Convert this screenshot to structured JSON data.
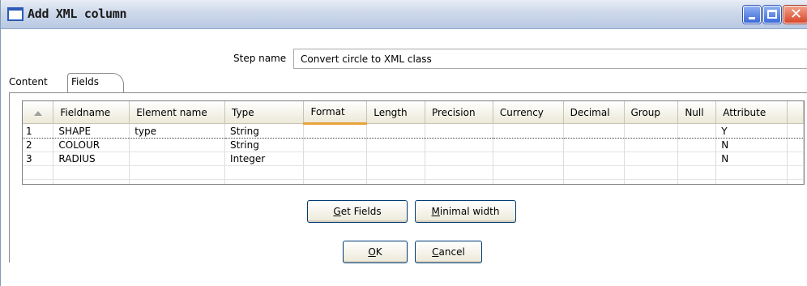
{
  "window": {
    "title": "Add XML column"
  },
  "step": {
    "label": "Step name",
    "value": "Convert circle to XML class"
  },
  "tabs": [
    {
      "label": "Content"
    },
    {
      "label": "Fields"
    }
  ],
  "grid": {
    "columns": [
      "",
      "Fieldname",
      "Element name",
      "Type",
      "Format",
      "Length",
      "Precision",
      "Currency",
      "Decimal",
      "Group",
      "Null",
      "Attribute"
    ],
    "rows": [
      [
        "1",
        "SHAPE",
        "type",
        "String",
        "",
        "",
        "",
        "",
        "",
        "",
        "",
        "Y"
      ],
      [
        "2",
        "COLOUR",
        "",
        "String",
        "",
        "",
        "",
        "",
        "",
        "",
        "",
        "N"
      ],
      [
        "3",
        "RADIUS",
        "",
        "Integer",
        "",
        "",
        "",
        "",
        "",
        "",
        "",
        "N"
      ],
      [
        "",
        "",
        "",
        "",
        "",
        "",
        "",
        "",
        "",
        "",
        "",
        ""
      ],
      [
        "",
        "",
        "",
        "",
        "",
        "",
        "",
        "",
        "",
        "",
        "",
        ""
      ]
    ]
  },
  "buttons": {
    "get_fields": {
      "mnemonic": "G",
      "rest": "et Fields"
    },
    "minimal_width": {
      "mnemonic": "M",
      "rest": "inimal width"
    },
    "ok": {
      "mnemonic": "O",
      "rest": "K"
    },
    "cancel": {
      "mnemonic": "C",
      "rest": "ancel"
    }
  },
  "icons": {
    "window": "window-icon",
    "minimize": "minimize-icon",
    "maximize": "maximize-icon",
    "close": "close-icon",
    "sort": "sort-asc-icon"
  },
  "colors": {
    "title_gradient_top": "#e8edf6",
    "title_gradient_bottom": "#b9c9e3",
    "sort_underline": "#e8a33a",
    "close_button": "#d9472a"
  }
}
